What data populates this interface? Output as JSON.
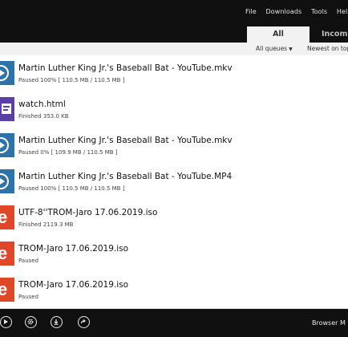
{
  "menu": {
    "file": "File",
    "downloads": "Downloads",
    "tools": "Tools",
    "help": "Help"
  },
  "tabs": {
    "all": "All",
    "incomplete": "Incom"
  },
  "filters": {
    "queues": "All queues",
    "sort": "Newest on top"
  },
  "downloads": [
    {
      "title": "Martin Luther King Jr.'s Baseball Bat - YouTube.mkv",
      "status": "Paused 100% [ 110.5 MB / 110.5 MB ]",
      "icon": "video-play-icon"
    },
    {
      "title": "watch.html",
      "status": "Finished 353.0 KB",
      "icon": "html-file-icon"
    },
    {
      "title": "Martin Luther King Jr.'s Baseball Bat - YouTube.mkv",
      "status": "Paused 0% [ 109.9 MB / 110.5 MB ]",
      "icon": "video-play-icon"
    },
    {
      "title": "Martin Luther King Jr.'s Baseball Bat - YouTube.MP4",
      "status": "Paused 100% [ 110.5 MB / 110.5 MB ]",
      "icon": "video-play-icon"
    },
    {
      "title": "UTF-8''TROM-Jaro 17.06.2019.iso",
      "status": "Finished 2119.3 MB",
      "icon": "iso-file-icon"
    },
    {
      "title": "TROM-Jaro 17.06.2019.iso",
      "status": "Paused",
      "icon": "iso-file-icon"
    },
    {
      "title": "TROM-Jaro 17.06.2019.iso",
      "status": "Paused",
      "icon": "iso-file-icon"
    }
  ],
  "bottom": {
    "browser_label": "Browser M"
  },
  "colors": {
    "bar_bg": "#101010",
    "video_icon": "#2d73a8",
    "html_icon": "#5b3fa5",
    "iso_icon": "#e0472a"
  }
}
